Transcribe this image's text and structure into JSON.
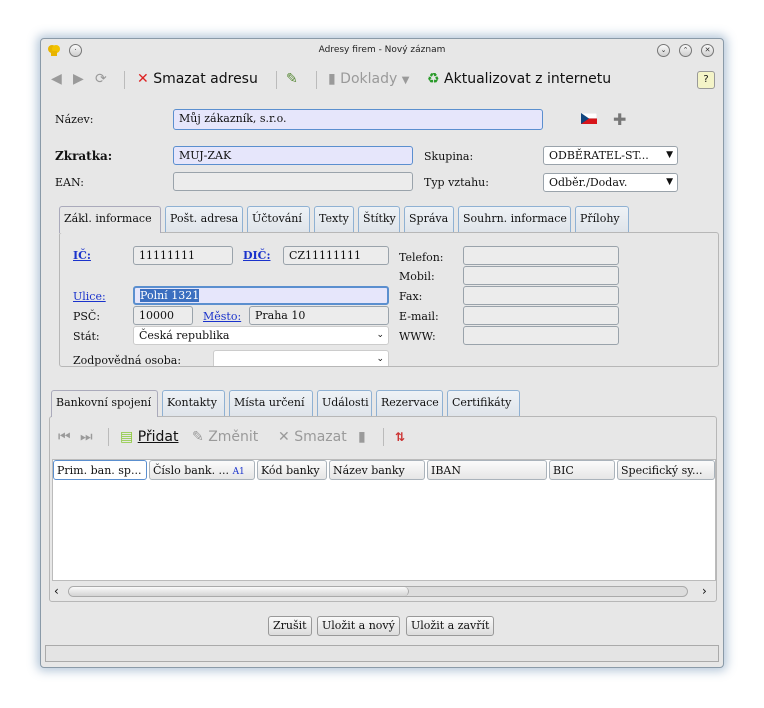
{
  "window": {
    "title": "Adresy firem - Nový záznam"
  },
  "toolbar": {
    "delete_label": "Smazat adresu",
    "documents_label": "Doklady",
    "update_label": "Aktualizovat z internetu"
  },
  "form": {
    "name_label": "Název:",
    "name_value": "Můj zákazník, s.r.o.",
    "abbrev_label": "Zkratka:",
    "abbrev_value": "MUJ-ZAK",
    "ean_label": "EAN:",
    "ean_value": "",
    "group_label": "Skupina:",
    "group_value": "ODBĚRATEL-ST...",
    "relation_label": "Typ vztahu:",
    "relation_value": "Odběr./Dodav."
  },
  "top_tabs": [
    "Zákl. informace",
    "Pošt. adresa",
    "Účtování",
    "Texty",
    "Štítky",
    "Správa",
    "Souhrn. informace",
    "Přílohy"
  ],
  "basic": {
    "ic_label": "IČ:",
    "ic_value": "11111111",
    "dic_label": "DIČ:",
    "dic_value": "CZ11111111",
    "street_label": "Ulice:",
    "street_value": "Polní 1321",
    "zip_label": "PSČ:",
    "zip_value": "10000",
    "city_label": "Město:",
    "city_value": "Praha 10",
    "country_label": "Stát:",
    "country_value": "Česká republika",
    "person_label": "Zodpovědná osoba:",
    "person_value": "",
    "phone_label": "Telefon:",
    "mobile_label": "Mobil:",
    "fax_label": "Fax:",
    "email_label": "E-mail:",
    "www_label": "WWW:"
  },
  "bottom_tabs": [
    "Bankovní spojení",
    "Kontakty",
    "Místa určení",
    "Události",
    "Rezervace",
    "Certifikáty"
  ],
  "bank_toolbar": {
    "add_label": "Přidat",
    "edit_label": "Změnit",
    "delete_label": "Smazat"
  },
  "bank_columns": [
    "Prim. ban. sp...",
    "Číslo bank. ...",
    "Kód banky",
    "Název banky",
    "IBAN",
    "BIC",
    "Specifický sy..."
  ],
  "sort_marker": "A1",
  "buttons": {
    "cancel": "Zrušit",
    "save_new": "Uložit a nový",
    "save_close": "Uložit a zavřít"
  },
  "colors": {
    "accent": "#5b8fcf",
    "link": "#1a33cc",
    "input_blue": "#e6e6fb"
  }
}
